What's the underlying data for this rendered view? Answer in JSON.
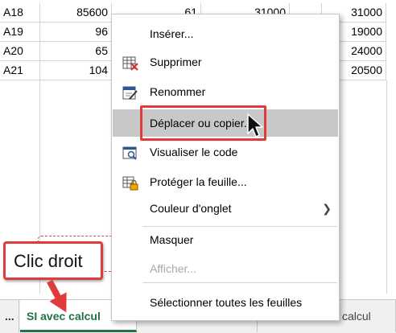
{
  "grid": {
    "rows": [
      {
        "label": "A18",
        "b": "85600",
        "c": "61",
        "d": "31000",
        "f": "31000"
      },
      {
        "label": "A19",
        "b": "96",
        "c": "",
        "d": "",
        "f": "19000"
      },
      {
        "label": "A20",
        "b": "65",
        "c": "",
        "d": "",
        "f": "24000"
      },
      {
        "label": "A21",
        "b": "104",
        "c": "",
        "d": "",
        "f": "20500"
      }
    ]
  },
  "context_menu": {
    "items": [
      {
        "label": "Insérer...",
        "icon": "none"
      },
      {
        "label": "Supprimer",
        "icon": "delete-sheet-icon"
      },
      {
        "label": "Renommer",
        "icon": "rename-icon"
      },
      {
        "label": "Déplacer ou copier...",
        "icon": "none"
      },
      {
        "label": "Visualiser le code",
        "icon": "view-code-icon"
      },
      {
        "label": "Protéger la feuille...",
        "icon": "protect-sheet-icon"
      },
      {
        "label": "Couleur d'onglet",
        "icon": "none"
      },
      {
        "label": "Masquer",
        "icon": "none"
      },
      {
        "label": "Afficher...",
        "icon": "none"
      },
      {
        "label": "Sélectionner toutes les feuilles",
        "icon": "none"
      }
    ],
    "hovered_index": 3,
    "disabled_index": 8
  },
  "callout": {
    "text": "Clic droit"
  },
  "tabs": {
    "ellipsis": "...",
    "active": "SI avec calcul",
    "tab2": "SI avec calcul",
    "tab3": "SI ET OU avec calcul"
  },
  "colors": {
    "accent": "#217346",
    "highlight": "#e03a3a",
    "hover": "#c8c8c8"
  }
}
